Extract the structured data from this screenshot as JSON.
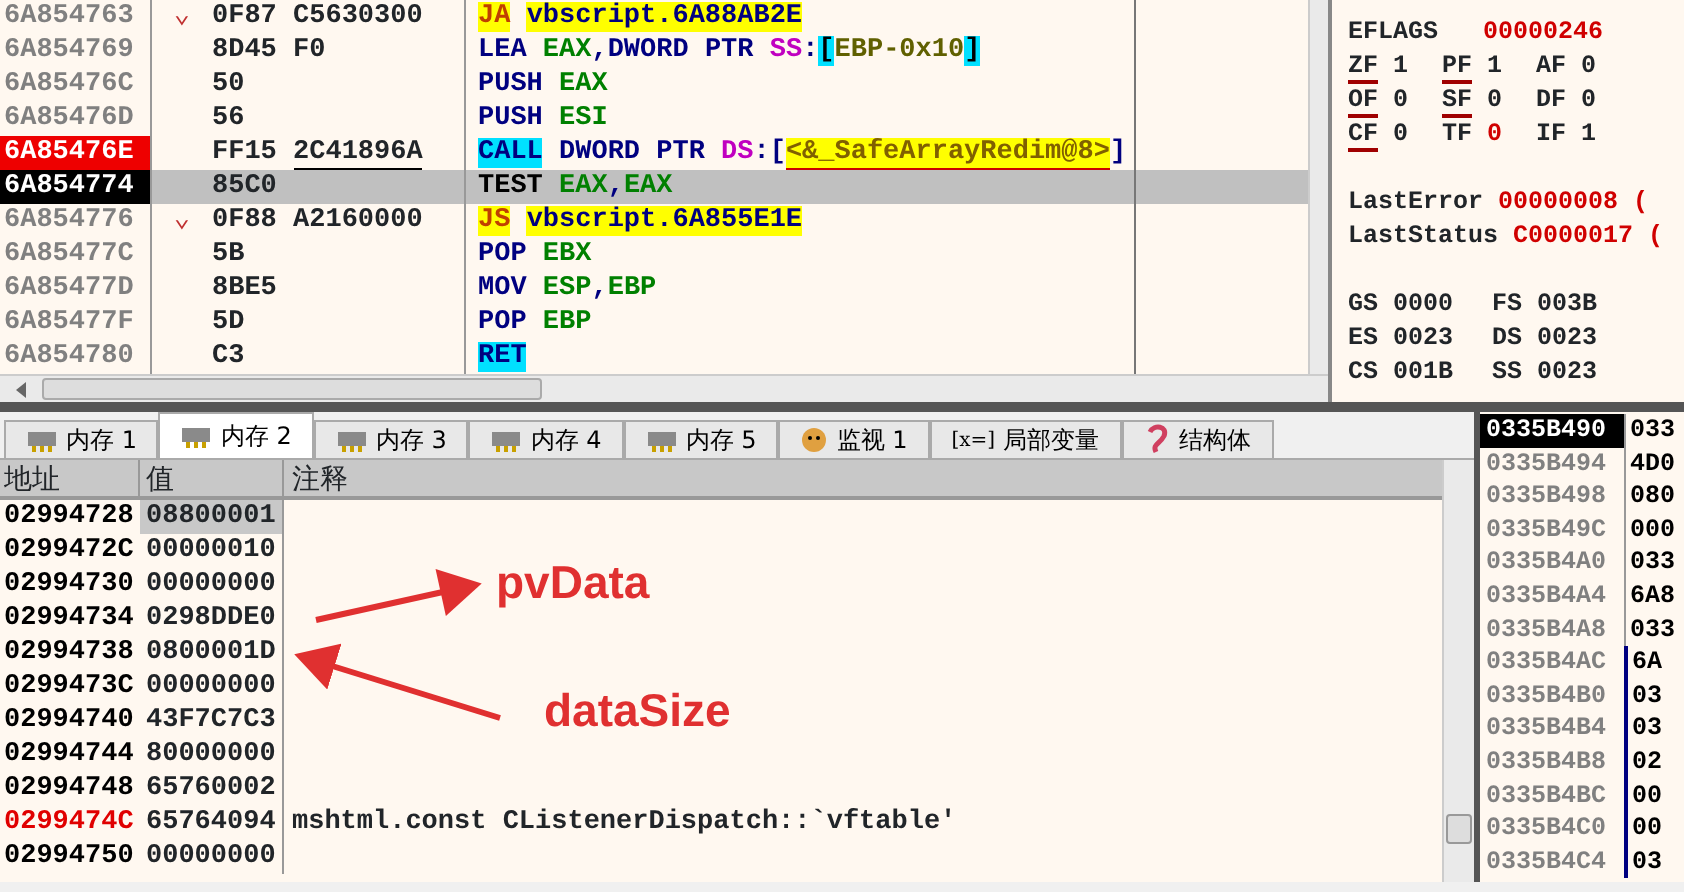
{
  "disassembly": {
    "rows": [
      {
        "address": "6A854763",
        "kind": "jump",
        "breakpoint": false,
        "current": false,
        "jump_mark": "⌄",
        "bytes": [
          "0F87",
          "C5630300"
        ],
        "mnemonic": "JA",
        "operands": [
          {
            "text": "vbscript.6A88AB2E",
            "kind": "target"
          }
        ]
      },
      {
        "address": "6A854769",
        "kind": "plain",
        "breakpoint": false,
        "current": false,
        "bytes": [
          "8D45",
          "F0"
        ],
        "mnemonic": "LEA",
        "operands": [
          {
            "text": "EAX",
            "kind": "reg"
          },
          {
            "text": ",DWORD PTR ",
            "kind": "text"
          },
          {
            "text": "SS",
            "kind": "seg"
          },
          {
            "text": ":",
            "kind": "text"
          },
          {
            "text": "[",
            "kind": "bracket"
          },
          {
            "text": "EBP-0x10",
            "kind": "mem"
          },
          {
            "text": "]",
            "kind": "bracket"
          }
        ]
      },
      {
        "address": "6A85476C",
        "kind": "plain",
        "breakpoint": false,
        "current": false,
        "bytes": [
          "50"
        ],
        "mnemonic": "PUSH",
        "operands": [
          {
            "text": "EAX",
            "kind": "reg"
          }
        ]
      },
      {
        "address": "6A85476D",
        "kind": "plain",
        "breakpoint": false,
        "current": false,
        "bytes": [
          "56"
        ],
        "mnemonic": "PUSH",
        "operands": [
          {
            "text": "ESI",
            "kind": "reg"
          }
        ]
      },
      {
        "address": "6A85476E",
        "kind": "call",
        "breakpoint": true,
        "current": false,
        "bytes": [
          "FF15",
          "2C41896A"
        ],
        "mnemonic": "CALL",
        "operands": [
          {
            "text": "DWORD PTR ",
            "kind": "text"
          },
          {
            "text": "DS",
            "kind": "seg"
          },
          {
            "text": ":[",
            "kind": "text"
          },
          {
            "text": "<&_SafeArrayRedim@8>",
            "kind": "symbol"
          },
          {
            "text": "]",
            "kind": "text"
          }
        ]
      },
      {
        "address": "6A854774",
        "kind": "test",
        "breakpoint": false,
        "current": true,
        "bytes": [
          "85C0"
        ],
        "mnemonic": "TEST",
        "operands": [
          {
            "text": "EAX",
            "kind": "reg"
          },
          {
            "text": ",",
            "kind": "text"
          },
          {
            "text": "EAX",
            "kind": "reg"
          }
        ]
      },
      {
        "address": "6A854776",
        "kind": "jump",
        "breakpoint": false,
        "current": false,
        "jump_mark": "⌄",
        "bytes": [
          "0F88",
          "A2160000"
        ],
        "mnemonic": "JS",
        "operands": [
          {
            "text": "vbscript.6A855E1E",
            "kind": "target"
          }
        ]
      },
      {
        "address": "6A85477C",
        "kind": "plain",
        "breakpoint": false,
        "current": false,
        "bytes": [
          "5B"
        ],
        "mnemonic": "POP",
        "operands": [
          {
            "text": "EBX",
            "kind": "reg"
          }
        ]
      },
      {
        "address": "6A85477D",
        "kind": "plain",
        "breakpoint": false,
        "current": false,
        "bytes": [
          "8BE5"
        ],
        "mnemonic": "MOV",
        "operands": [
          {
            "text": "ESP",
            "kind": "reg"
          },
          {
            "text": ",",
            "kind": "text"
          },
          {
            "text": "EBP",
            "kind": "reg"
          }
        ]
      },
      {
        "address": "6A85477F",
        "kind": "plain",
        "breakpoint": false,
        "current": false,
        "bytes": [
          "5D"
        ],
        "mnemonic": "POP",
        "operands": [
          {
            "text": "EBP",
            "kind": "reg"
          }
        ]
      },
      {
        "address": "6A854780",
        "kind": "call",
        "breakpoint": false,
        "current": false,
        "bytes": [
          "C3"
        ],
        "mnemonic": "RET",
        "operands": []
      }
    ]
  },
  "registers": {
    "eflags": {
      "label": "EFLAGS",
      "value": "00000246"
    },
    "flags": [
      {
        "name": "ZF",
        "value": "1",
        "marked": true,
        "changed": false
      },
      {
        "name": "PF",
        "value": "1",
        "marked": true,
        "changed": false
      },
      {
        "name": "AF",
        "value": "0",
        "marked": false,
        "changed": false
      },
      {
        "name": "OF",
        "value": "0",
        "marked": true,
        "changed": false
      },
      {
        "name": "SF",
        "value": "0",
        "marked": true,
        "changed": false
      },
      {
        "name": "DF",
        "value": "0",
        "marked": false,
        "changed": false
      },
      {
        "name": "CF",
        "value": "0",
        "marked": true,
        "changed": false
      },
      {
        "name": "TF",
        "value": "0",
        "marked": false,
        "changed": true
      },
      {
        "name": "IF",
        "value": "1",
        "marked": false,
        "changed": false
      }
    ],
    "last": [
      {
        "label": "LastError",
        "value": "00000008 ("
      },
      {
        "label": "LastStatus",
        "value": "C0000017 ("
      }
    ],
    "segments": [
      {
        "name": "GS",
        "value": "0000"
      },
      {
        "name": "FS",
        "value": "003B"
      },
      {
        "name": "ES",
        "value": "0023"
      },
      {
        "name": "DS",
        "value": "0023"
      },
      {
        "name": "CS",
        "value": "001B"
      },
      {
        "name": "SS",
        "value": "0023"
      }
    ]
  },
  "memory_tabs": [
    {
      "label": "内存 1",
      "kind": "memory",
      "selected": false
    },
    {
      "label": "内存 2",
      "kind": "memory",
      "selected": true
    },
    {
      "label": "内存 3",
      "kind": "memory",
      "selected": false
    },
    {
      "label": "内存 4",
      "kind": "memory",
      "selected": false
    },
    {
      "label": "内存 5",
      "kind": "memory",
      "selected": false
    },
    {
      "label": "监视 1",
      "kind": "watch",
      "selected": false
    },
    {
      "label": "局部变量",
      "kind": "locals",
      "icon_text": "[x=]",
      "selected": false
    },
    {
      "label": "结构体",
      "kind": "struct",
      "selected": false
    }
  ],
  "memory": {
    "columns": [
      "地址",
      "值",
      "注释"
    ],
    "rows": [
      {
        "address": "02994728",
        "value": "08800001",
        "highlight": false,
        "selected": true
      },
      {
        "address": "0299472C",
        "value": "00000010",
        "highlight": false,
        "selected": false
      },
      {
        "address": "02994730",
        "value": "00000000",
        "highlight": false,
        "selected": false
      },
      {
        "address": "02994734",
        "value": "0298DDE0",
        "highlight": false,
        "selected": false
      },
      {
        "address": "02994738",
        "value": "0800001D",
        "highlight": false,
        "selected": false
      },
      {
        "address": "0299473C",
        "value": "00000000",
        "highlight": false,
        "selected": false
      },
      {
        "address": "02994740",
        "value": "43F7C7C3",
        "highlight": false,
        "selected": false
      },
      {
        "address": "02994744",
        "value": "80000000",
        "highlight": false,
        "selected": false
      },
      {
        "address": "02994748",
        "value": "65760002",
        "highlight": false,
        "selected": false
      },
      {
        "address": "0299474C",
        "value": "65764094",
        "comment": "mshtml.const CListenerDispatch::`vftable'",
        "highlight": true,
        "selected": false
      },
      {
        "address": "02994750",
        "value": "00000000",
        "highlight": false,
        "selected": false
      }
    ]
  },
  "annotations": [
    {
      "text": "pvData"
    },
    {
      "text": "dataSize"
    }
  ],
  "stack": {
    "rows": [
      {
        "address": "0335B490",
        "value": "033",
        "selected": true,
        "bracket": false
      },
      {
        "address": "0335B494",
        "value": "4D0",
        "selected": false,
        "bracket": false
      },
      {
        "address": "0335B498",
        "value": "080",
        "selected": false,
        "bracket": false
      },
      {
        "address": "0335B49C",
        "value": "000",
        "selected": false,
        "bracket": false
      },
      {
        "address": "0335B4A0",
        "value": "033",
        "selected": false,
        "bracket": false
      },
      {
        "address": "0335B4A4",
        "value": "6A8",
        "selected": false,
        "bracket": false
      },
      {
        "address": "0335B4A8",
        "value": "033",
        "selected": false,
        "bracket": false
      },
      {
        "address": "0335B4AC",
        "value": "6A",
        "selected": false,
        "bracket": true
      },
      {
        "address": "0335B4B0",
        "value": "03",
        "selected": false,
        "bracket": true
      },
      {
        "address": "0335B4B4",
        "value": "03",
        "selected": false,
        "bracket": true
      },
      {
        "address": "0335B4B8",
        "value": "02",
        "selected": false,
        "bracket": true
      },
      {
        "address": "0335B4BC",
        "value": "00",
        "selected": false,
        "bracket": true
      },
      {
        "address": "0335B4C0",
        "value": "00",
        "selected": false,
        "bracket": true
      },
      {
        "address": "0335B4C4",
        "value": "03",
        "selected": false,
        "bracket": true
      }
    ]
  }
}
